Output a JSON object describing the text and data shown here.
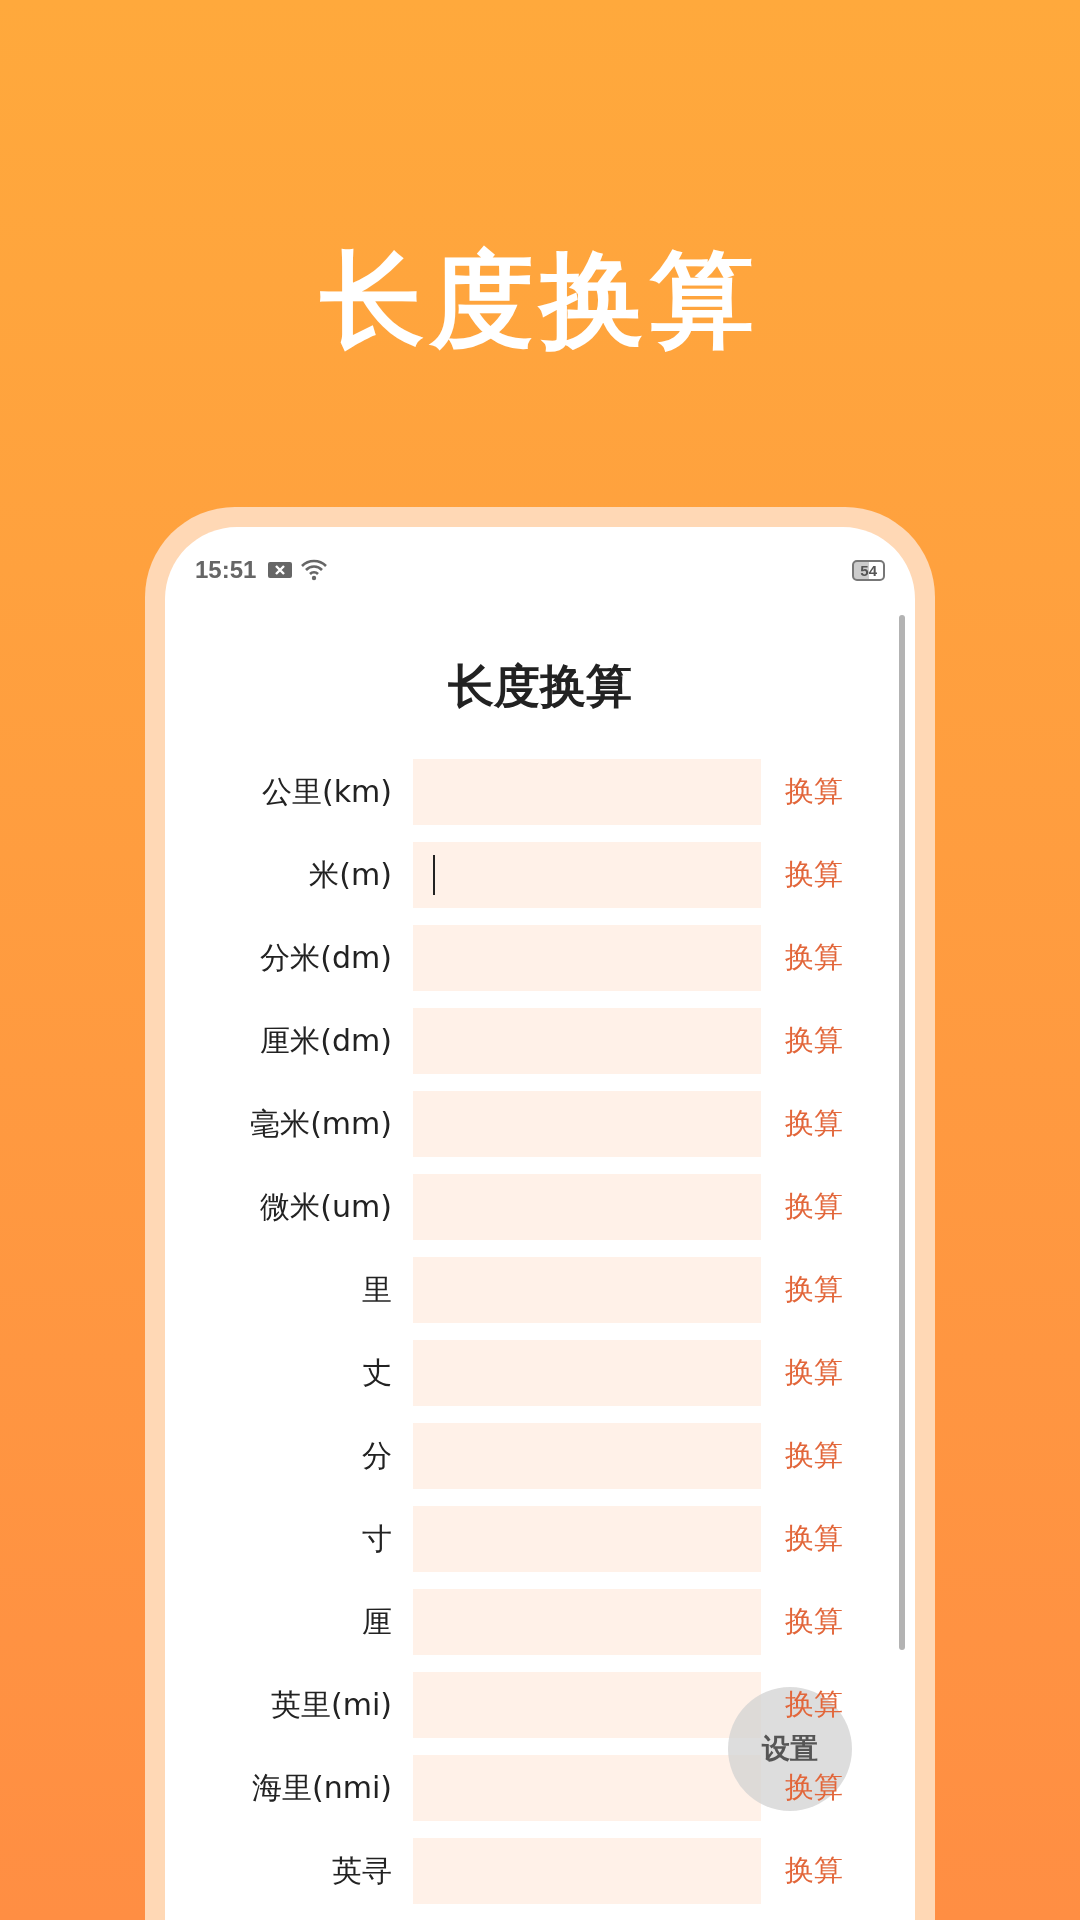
{
  "banner_title": "长度换算",
  "status_bar": {
    "time": "15:51",
    "battery": "54"
  },
  "screen_title": "长度换算",
  "rows": [
    {
      "label": "公里(km)",
      "button": "换算",
      "focused": false
    },
    {
      "label": "米(m)",
      "button": "换算",
      "focused": true
    },
    {
      "label": "分米(dm)",
      "button": "换算",
      "focused": false
    },
    {
      "label": "厘米(dm)",
      "button": "换算",
      "focused": false
    },
    {
      "label": "毫米(mm)",
      "button": "换算",
      "focused": false
    },
    {
      "label": "微米(um)",
      "button": "换算",
      "focused": false
    },
    {
      "label": "里",
      "button": "换算",
      "focused": false
    },
    {
      "label": "丈",
      "button": "换算",
      "focused": false
    },
    {
      "label": "分",
      "button": "换算",
      "focused": false
    },
    {
      "label": "寸",
      "button": "换算",
      "focused": false
    },
    {
      "label": "厘",
      "button": "换算",
      "focused": false
    },
    {
      "label": "英里(mi)",
      "button": "换算",
      "focused": false
    },
    {
      "label": "海里(nmi)",
      "button": "换算",
      "focused": false
    },
    {
      "label": "英寻",
      "button": "换算",
      "focused": false
    }
  ],
  "fab": "设置"
}
